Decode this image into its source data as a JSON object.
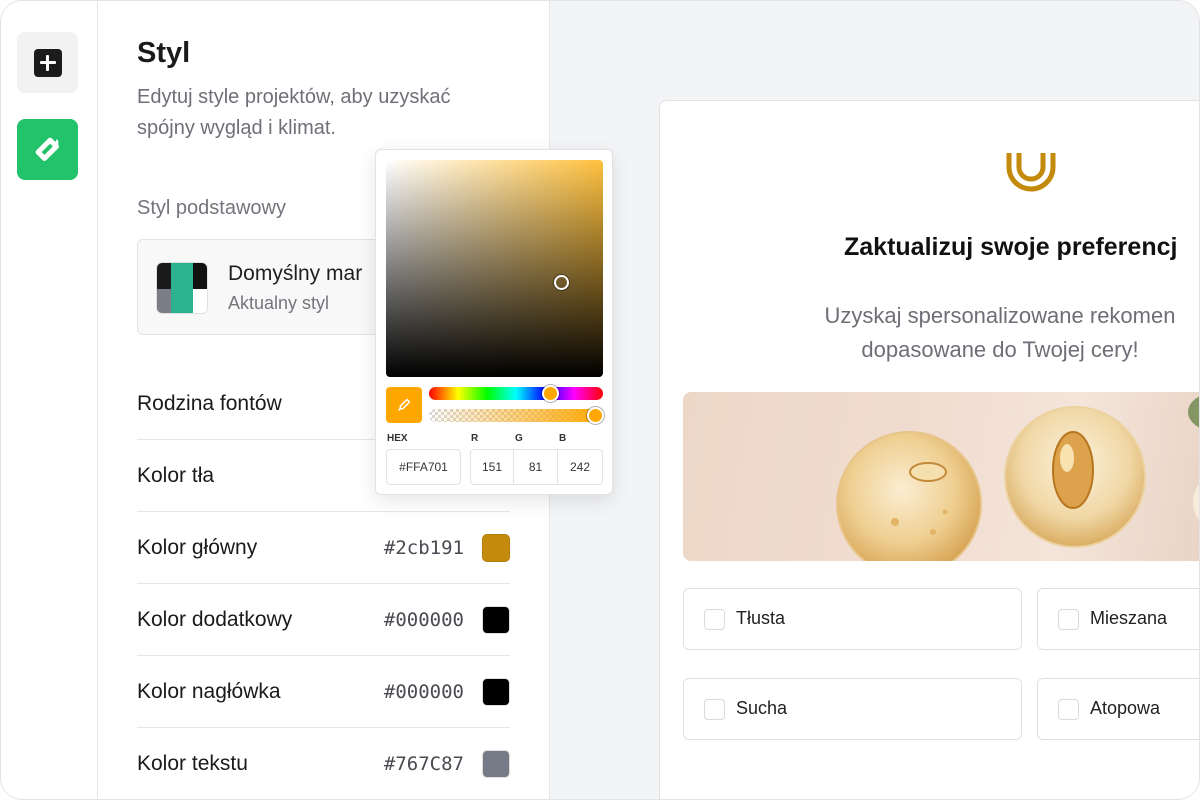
{
  "rail": {
    "items": [
      {
        "name": "add",
        "icon": "plus-square-icon"
      },
      {
        "name": "style",
        "icon": "paint-bucket-icon",
        "color": "#22c36a"
      }
    ]
  },
  "panel": {
    "title": "Styl",
    "description": "Edytuj style projektów, aby uzyskać spójny wygląd i klimat.",
    "base_style_label": "Styl podstawowy",
    "style_card": {
      "name": "Domyślny mar",
      "subtitle": "Aktualny styl"
    },
    "rows": [
      {
        "label": "Rodzina fontów",
        "hex": "",
        "color": ""
      },
      {
        "label": "Kolor tła",
        "hex": "",
        "color": ""
      },
      {
        "label": "Kolor główny",
        "hex": "#2cb191",
        "color": "#c48a0b"
      },
      {
        "label": "Kolor dodatkowy",
        "hex": "#000000",
        "color": "#000000"
      },
      {
        "label": "Kolor nagłówka",
        "hex": "#000000",
        "color": "#000000"
      },
      {
        "label": "Kolor tekstu",
        "hex": "#767C87",
        "color": "#767c87"
      }
    ]
  },
  "picker": {
    "hex_label": "HEX",
    "hex_value": "#FFA701",
    "r_label": "R",
    "r_value": "151",
    "g_label": "G",
    "g_value": "81",
    "b_label": "B",
    "b_value": "242",
    "accent": "#ffa701"
  },
  "preview": {
    "title": "Zaktualizuj swoje preferencj",
    "subtitle_line1": "Uzyskaj spersonalizowane rekomen",
    "subtitle_line2": "dopasowane do Twojej cery!",
    "options": [
      "Tłusta",
      "Mieszana",
      "Sucha",
      "Atopowa"
    ],
    "logo_color": "#c48a0b"
  }
}
